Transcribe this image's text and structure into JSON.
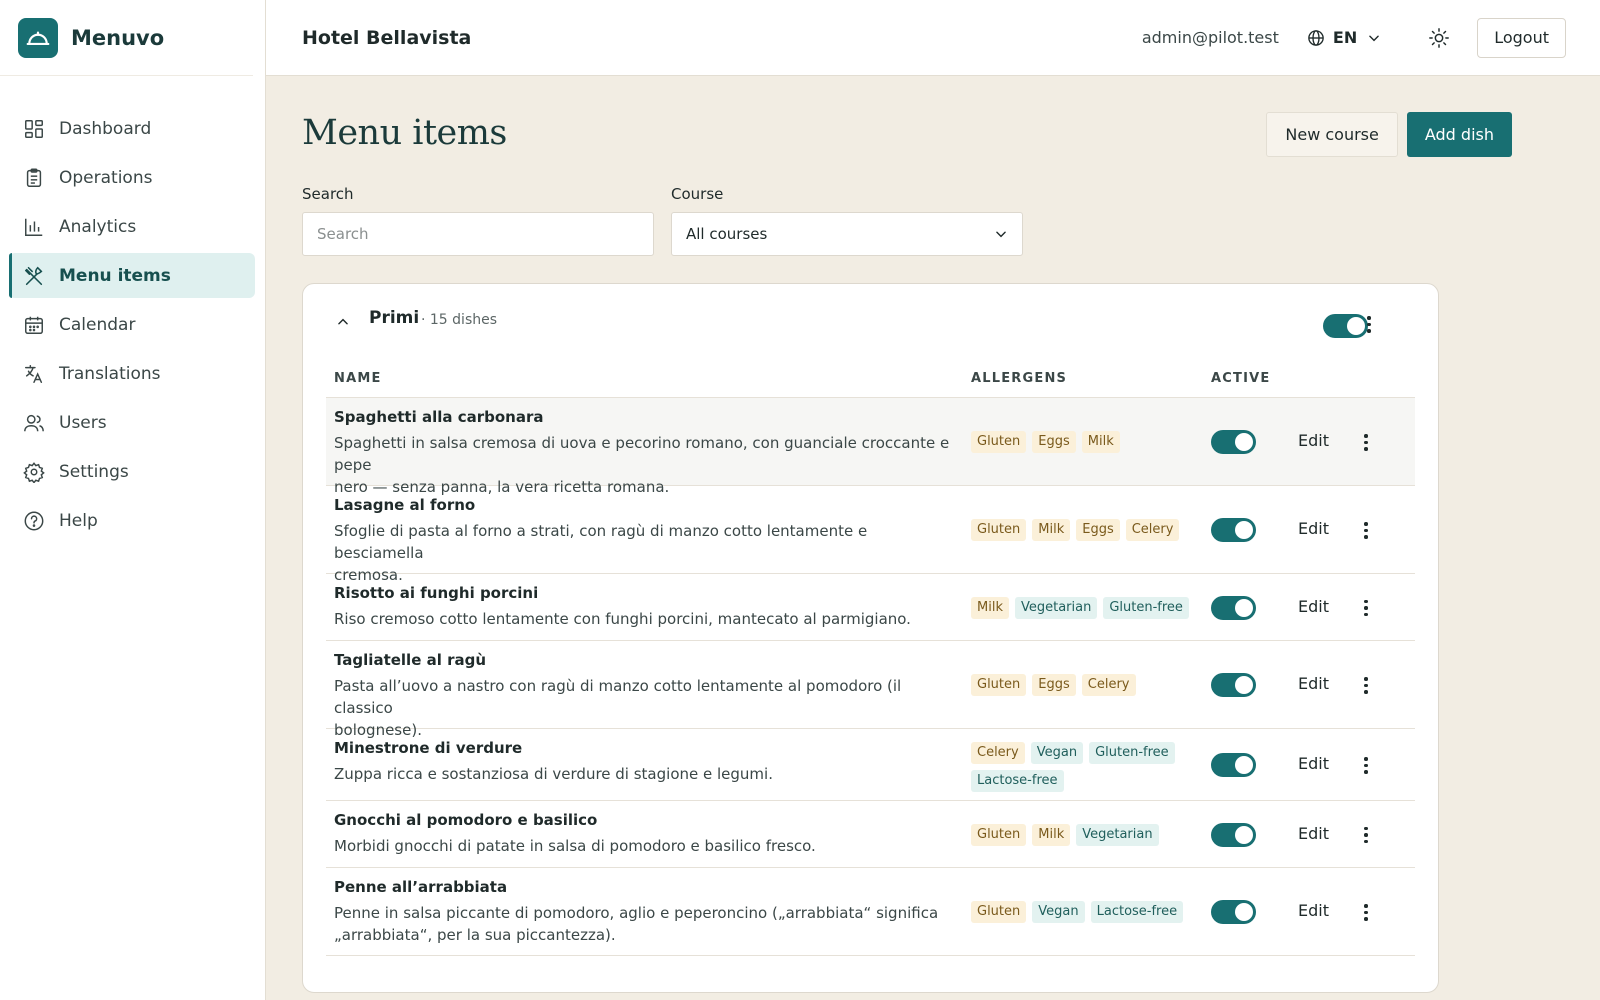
{
  "brand": {
    "name": "Menuvo",
    "accent": "#186f72"
  },
  "sidebar": {
    "items": [
      {
        "label": "Dashboard",
        "icon": "grid-icon"
      },
      {
        "label": "Operations",
        "icon": "clipboard-icon"
      },
      {
        "label": "Analytics",
        "icon": "bar-chart-icon"
      },
      {
        "label": "Menu items",
        "icon": "utensils-icon",
        "active": true
      },
      {
        "label": "Calendar",
        "icon": "calendar-icon"
      },
      {
        "label": "Translations",
        "icon": "translate-icon"
      },
      {
        "label": "Users",
        "icon": "users-icon"
      },
      {
        "label": "Settings",
        "icon": "gear-icon"
      },
      {
        "label": "Help",
        "icon": "help-circle-icon"
      }
    ]
  },
  "header": {
    "hotel": "Hotel Bellavista",
    "email": "admin@pilot.test",
    "language": "EN",
    "logout_label": "Logout"
  },
  "page": {
    "title": "Menu items",
    "new_course_label": "New course",
    "add_dish_label": "Add dish",
    "search_label": "Search",
    "search_placeholder": "Search",
    "course_label": "Course",
    "course_value": "All courses"
  },
  "course": {
    "name": "Primi",
    "count": "· 15 dishes",
    "active": true,
    "columns": {
      "name": "NAME",
      "allergens": "ALLERGENS",
      "active": "ACTIVE"
    },
    "edit_label": "Edit"
  },
  "dishes": [
    {
      "name": "Spaghetti alla carbonara",
      "desc_line1": "Spaghetti in salsa cremosa di uova e pecorino romano, con guanciale croccante e pepe",
      "desc_line2": "nero — senza panna, la vera ricetta romana.",
      "tags": [
        "Gluten",
        "Eggs",
        "Milk"
      ],
      "active": true
    },
    {
      "name": "Lasagne al forno",
      "desc_line1": "Sfoglie di pasta al forno a strati, con ragù di manzo cotto lentamente e besciamella",
      "desc_line2": "cremosa.",
      "tags": [
        "Gluten",
        "Milk",
        "Eggs",
        "Celery"
      ],
      "active": true
    },
    {
      "name": "Risotto ai funghi porcini",
      "desc_line1": "Riso cremoso cotto lentamente con funghi porcini, mantecato al parmigiano.",
      "desc_line2": "",
      "tags": [
        "Milk",
        "Vegetarian",
        "Gluten-free"
      ],
      "active": true
    },
    {
      "name": "Tagliatelle al ragù",
      "desc_line1": "Pasta all’uovo a nastro con ragù di manzo cotto lentamente al pomodoro (il classico",
      "desc_line2": "bolognese).",
      "tags": [
        "Gluten",
        "Eggs",
        "Celery"
      ],
      "active": true
    },
    {
      "name": "Minestrone di verdure",
      "desc_line1": "Zuppa ricca e sostanziosa di verdure di stagione e legumi.",
      "desc_line2": "",
      "tags": [
        "Celery",
        "Vegan",
        "Gluten-free",
        "Lactose-free"
      ],
      "active": true
    },
    {
      "name": "Gnocchi al pomodoro e basilico",
      "desc_line1": "Morbidi gnocchi di patate in salsa di pomodoro e basilico fresco.",
      "desc_line2": "",
      "tags": [
        "Gluten",
        "Milk",
        "Vegetarian"
      ],
      "active": true
    },
    {
      "name": "Penne all’arrabbiata",
      "desc_line1": "Penne in salsa piccante di pomodoro, aglio e peperoncino („arrabbiata“ significa",
      "desc_line2": "„arrabbiata“, per la sua piccantezza).",
      "tags": [
        "Gluten",
        "Vegan",
        "Lactose-free"
      ],
      "active": true
    }
  ],
  "tag_colors": {
    "allergen_bg": "#fbf0d9",
    "diet_bg": "#e3f2f0"
  }
}
